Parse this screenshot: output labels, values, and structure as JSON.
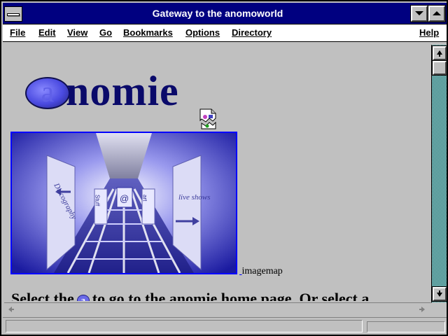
{
  "window": {
    "title": "Gateway to the anomoworld"
  },
  "menu": {
    "file": "File",
    "edit": "Edit",
    "view": "View",
    "go": "Go",
    "bookmarks": "Bookmarks",
    "options": "Options",
    "directory": "Directory",
    "help": "Help"
  },
  "content": {
    "logo_at": "a",
    "logo_word": "nomie",
    "imagemap_caption": "imagemap",
    "imagemap_text": {
      "left_panel": "Discography",
      "center_left": "Stuff",
      "center_right": "art",
      "center_at": "@",
      "right_panel": "live shows"
    },
    "bottom_text_start": "Select the",
    "bottom_text_end": "to go to the anomie home page. Or select a",
    "inline_icon": "a"
  },
  "colors": {
    "titlebar": "#000080",
    "link_border": "#0000ff",
    "logo_text": "#0a0a6a",
    "scroll_track": "#008080"
  },
  "icons": [
    "system-menu-icon",
    "minimize-icon",
    "maximize-icon",
    "broken-image-icon",
    "scroll-up-icon",
    "scroll-down-icon",
    "scroll-left-icon",
    "scroll-right-icon"
  ]
}
